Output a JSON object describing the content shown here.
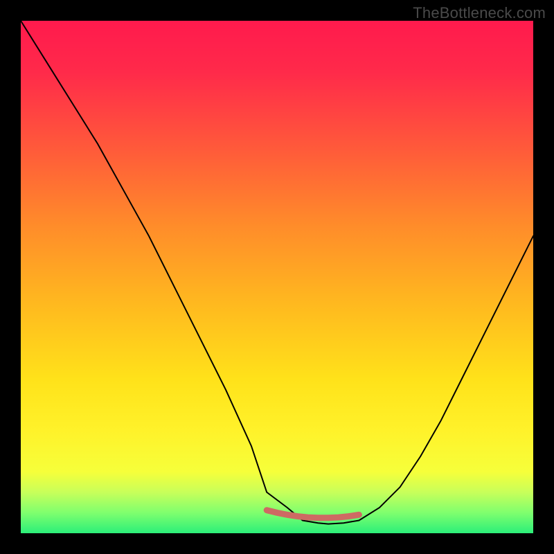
{
  "attribution": "TheBottleneck.com",
  "chart_data": {
    "type": "line",
    "title": "",
    "xlabel": "",
    "ylabel": "",
    "x_range": [
      0,
      100
    ],
    "y_range": [
      0,
      100
    ],
    "grid": false,
    "series": [
      {
        "name": "bottleneck-curve",
        "x": [
          0,
          5,
          10,
          15,
          20,
          25,
          30,
          35,
          40,
          45,
          48,
          52,
          55,
          58,
          60,
          63,
          66,
          70,
          74,
          78,
          82,
          86,
          90,
          95,
          100
        ],
        "values": [
          100,
          92,
          84,
          76,
          67,
          58,
          48,
          38,
          28,
          17,
          8,
          5,
          2.5,
          2,
          1.8,
          2,
          2.5,
          5,
          9,
          15,
          22,
          30,
          38,
          48,
          58
        ]
      },
      {
        "name": "optimal-band",
        "x": [
          48,
          50,
          52,
          54,
          56,
          58,
          60,
          62,
          64,
          66
        ],
        "values": [
          4.5,
          4.0,
          3.6,
          3.3,
          3.1,
          3.0,
          3.0,
          3.1,
          3.3,
          3.6
        ]
      }
    ],
    "annotations": []
  }
}
